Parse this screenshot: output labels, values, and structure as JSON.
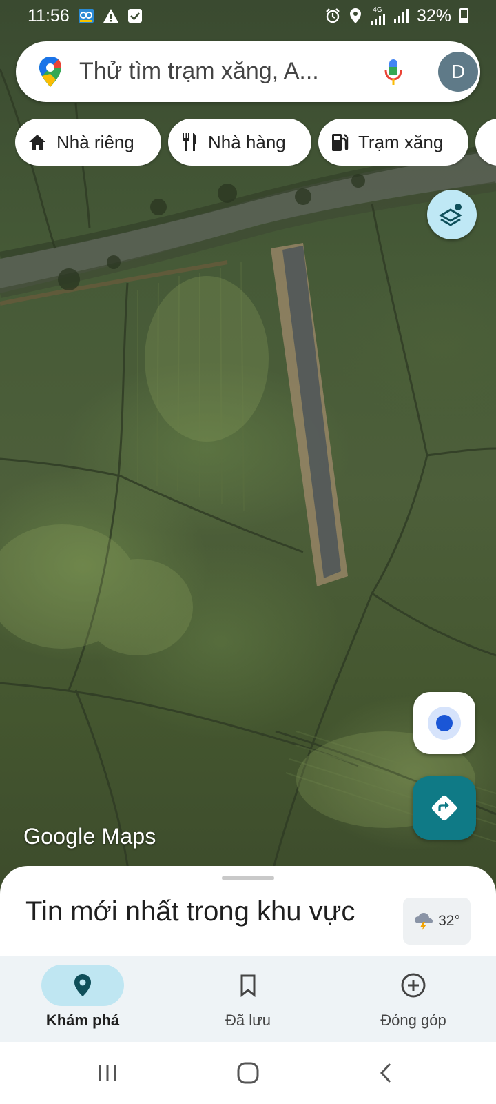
{
  "status_bar": {
    "time": "11:56",
    "battery": "32%",
    "network": "4G",
    "left_icons": [
      "app-notification-icon",
      "warning-icon",
      "checkbox-icon"
    ],
    "right_icons": [
      "alarm-icon",
      "location-icon",
      "signal-icon",
      "signal-icon",
      "battery-icon"
    ]
  },
  "search": {
    "placeholder": "Thử tìm trạm xăng, A...",
    "avatar_letter": "D"
  },
  "chips": [
    {
      "label": "Nhà riêng",
      "icon": "home-icon"
    },
    {
      "label": "Nhà hàng",
      "icon": "restaurant-icon"
    },
    {
      "label": "Trạm xăng",
      "icon": "gas-station-icon"
    }
  ],
  "map": {
    "brand": "Google Maps",
    "layers_icon": "layers-icon",
    "location_icon": "my-location-icon",
    "directions_icon": "directions-icon"
  },
  "sheet": {
    "title": "Tin mới nhất trong khu vực",
    "weather": "32°",
    "weather_icon": "thunderstorm-icon"
  },
  "nav": [
    {
      "label": "Khám phá",
      "icon": "explore-pin-icon",
      "active": true
    },
    {
      "label": "Đã lưu",
      "icon": "bookmark-icon",
      "active": false
    },
    {
      "label": "Đóng góp",
      "icon": "add-circle-icon",
      "active": false
    }
  ],
  "colors": {
    "accent": "#0f7a86",
    "active_pill": "#bfe6f2",
    "layers_button": "#bfe8f5",
    "location_dot": "#1a56d6"
  }
}
